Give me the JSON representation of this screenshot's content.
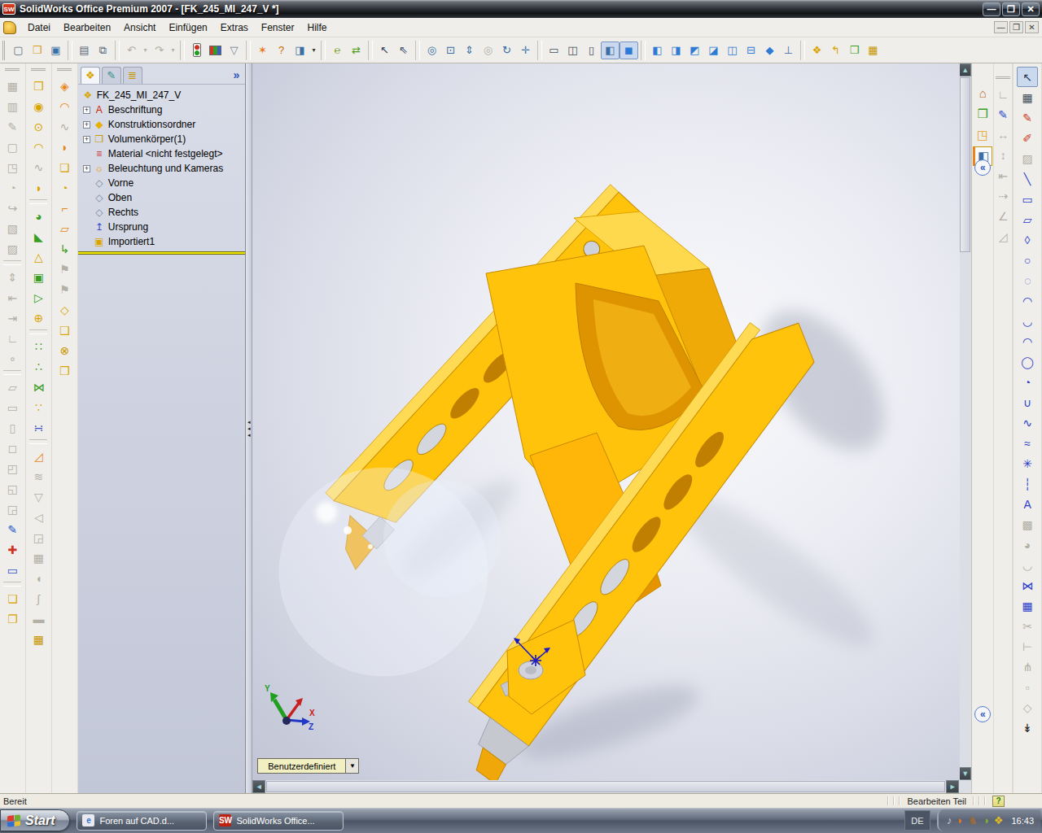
{
  "window": {
    "logo_text": "SW",
    "title": "SolidWorks Office Premium 2007 - [FK_245_MI_247_V *]",
    "controls": [
      {
        "n": "minimize",
        "g": "—"
      },
      {
        "n": "restore",
        "g": "❐"
      },
      {
        "n": "close",
        "g": "✕"
      }
    ]
  },
  "menubar": {
    "menus": [
      "Datei",
      "Bearbeiten",
      "Ansicht",
      "Einfügen",
      "Extras",
      "Fenster",
      "Hilfe"
    ],
    "mdi": [
      {
        "n": "mdi-minimize",
        "g": "—"
      },
      {
        "n": "mdi-restore",
        "g": "❐"
      },
      {
        "n": "mdi-close",
        "g": "✕"
      }
    ]
  },
  "toolbars": {
    "top": [
      "=",
      {
        "n": "new-document",
        "g": "▢",
        "c": "#5A6B7C"
      },
      {
        "n": "open-document",
        "g": "❒",
        "c": "#D99A1E"
      },
      {
        "n": "save",
        "g": "▣",
        "c": "#3A6EA5"
      },
      "|",
      {
        "n": "print",
        "g": "▤",
        "c": "#5A6B7C"
      },
      {
        "n": "print-preview",
        "g": "⧉",
        "c": "#5A6B7C"
      },
      "|",
      {
        "n": "undo",
        "g": "↶",
        "dis": 1
      },
      {
        "n": "undo-dropdown",
        "g": "▾",
        "dis": 1,
        "sm": 1
      },
      {
        "n": "redo",
        "g": "↷",
        "dis": 1
      },
      {
        "n": "redo-dropdown",
        "g": "▾",
        "dis": 1,
        "sm": 1
      },
      "|",
      {
        "n": "rebuild",
        "cls": "tl",
        "g": " "
      },
      {
        "n": "edit-color",
        "cls": "pal",
        "g": " "
      },
      {
        "n": "selection-filter",
        "g": "▽",
        "c": "#6A7B8C"
      },
      "|",
      {
        "n": "whats-wrong",
        "g": "✶",
        "c": "#E87B1E"
      },
      {
        "n": "help",
        "g": "?",
        "c": "#C96A00"
      },
      {
        "n": "task-pane-toggle",
        "g": "◨",
        "c": "#3A6EA5"
      },
      {
        "n": "task-pane-dropdown",
        "g": "▾",
        "c": "#333",
        "sm": 1
      },
      "|",
      {
        "n": "edrawings-publish",
        "g": "℮",
        "c": "#7AA11E"
      },
      {
        "n": "edrawings-animate",
        "g": "⇄",
        "c": "#4E9E1E"
      },
      "|",
      {
        "n": "select",
        "g": "↖",
        "c": "#2A3B56"
      },
      {
        "n": "magnified-selection",
        "g": "⇖",
        "c": "#2A3B56"
      },
      "|",
      {
        "n": "zoom-to-fit",
        "g": "◎",
        "c": "#3A6EA5"
      },
      {
        "n": "zoom-to-area",
        "g": "⊡",
        "c": "#3A6EA5"
      },
      {
        "n": "zoom-in-out",
        "g": "⇕",
        "c": "#3A6EA5"
      },
      {
        "n": "zoom-to-selection",
        "g": "◎",
        "dis": 1
      },
      {
        "n": "rotate-view",
        "g": "↻",
        "c": "#3A6EA5"
      },
      {
        "n": "pan",
        "g": "✛",
        "c": "#3A6EA5"
      },
      "|",
      {
        "n": "wireframe",
        "g": "▭",
        "c": "#44505C"
      },
      {
        "n": "hidden-lines-visible",
        "g": "◫",
        "c": "#44505C"
      },
      {
        "n": "hidden-lines-removed",
        "g": "▯",
        "c": "#44505C"
      },
      {
        "n": "shaded-with-edges",
        "g": "◧",
        "c": "#3A6EA5",
        "pr": 1
      },
      {
        "n": "shaded",
        "g": "◼",
        "c": "#2E7BD6",
        "pr": 1
      },
      "|",
      {
        "n": "view-front",
        "g": "◧",
        "c": "#2E7BD6"
      },
      {
        "n": "view-back",
        "g": "◨",
        "c": "#2E7BD6"
      },
      {
        "n": "view-left",
        "g": "◩",
        "c": "#2E7BD6"
      },
      {
        "n": "view-right",
        "g": "◪",
        "c": "#2E7BD6"
      },
      {
        "n": "view-top",
        "g": "◫",
        "c": "#2E7BD6"
      },
      {
        "n": "view-bottom",
        "g": "⊟",
        "c": "#2E7BD6"
      },
      {
        "n": "view-isometric",
        "g": "◆",
        "c": "#2E7BD6"
      },
      {
        "n": "normal-to",
        "g": "⊥",
        "c": "#3A6EA5"
      },
      "|",
      {
        "n": "photoworks-render",
        "g": "❖",
        "c": "#D9A400"
      },
      {
        "n": "featureworks",
        "g": "↰",
        "c": "#D9A400"
      },
      {
        "n": "design-binder",
        "g": "❒",
        "c": "#3A9D23"
      },
      {
        "n": "toolbox",
        "g": "▦",
        "c": "#C99700"
      }
    ],
    "left1": [
      "=",
      {
        "n": "make-block",
        "g": "▦",
        "dis": 1
      },
      {
        "n": "edit-block",
        "g": "▥",
        "dis": 1
      },
      {
        "n": "insert-block",
        "g": "✎",
        "dis": 1
      },
      {
        "n": "add-to-library",
        "g": "▢",
        "dis": 1
      },
      {
        "n": "save-block",
        "g": "◳",
        "dis": 1
      },
      {
        "n": "explode-block",
        "g": "◔",
        "dis": 1
      },
      {
        "n": "belt-chain",
        "g": "↪",
        "dis": 1
      },
      {
        "n": "format-painter",
        "g": "▧",
        "dis": 1
      },
      {
        "n": "area-hatch-fill",
        "g": "▨",
        "dis": 1
      },
      "|",
      {
        "n": "vertical-dimension",
        "g": "⇕",
        "dis": 1
      },
      {
        "n": "baseline-dimension",
        "g": "⇤",
        "dis": 1
      },
      {
        "n": "ordinate-dimension",
        "g": "⇥",
        "dis": 1
      },
      {
        "n": "chamfer-dimension",
        "g": "∟",
        "dis": 1
      },
      {
        "n": "point-dimension",
        "g": "∘",
        "dis": 1
      },
      "|",
      {
        "n": "view-cube-1",
        "g": "▱",
        "dis": 1
      },
      {
        "n": "view-cube-2",
        "g": "▭",
        "dis": 1
      },
      {
        "n": "view-cube-3",
        "g": "▯",
        "dis": 1
      },
      {
        "n": "view-cube-4",
        "g": "◻",
        "dis": 1
      },
      {
        "n": "view-cube-5",
        "g": "◰",
        "dis": 1
      },
      {
        "n": "view-cube-6",
        "g": "◱",
        "dis": 1
      },
      {
        "n": "view-cube-7",
        "g": "◲",
        "dis": 1
      },
      {
        "n": "sketch-tool",
        "g": "✎",
        "c": "#2255CC"
      },
      {
        "n": "derived-sketch",
        "g": "✚",
        "c": "#CC3322"
      },
      {
        "n": "sketch-picture",
        "g": "▭",
        "c": "#3355CC"
      },
      "|",
      {
        "n": "planar-surface",
        "g": "❏",
        "c": "#D9A400"
      },
      {
        "n": "offset-surface",
        "g": "❐",
        "c": "#D9A400"
      }
    ],
    "left2": [
      "=",
      {
        "n": "extruded-boss",
        "g": "❒",
        "c": "#D9A400"
      },
      {
        "n": "revolved-boss",
        "g": "◉",
        "c": "#D9A400"
      },
      {
        "n": "revolve-thin",
        "g": "⊙",
        "c": "#D9A400"
      },
      {
        "n": "dome",
        "g": "◠",
        "c": "#D9A400"
      },
      {
        "n": "swept-boss",
        "g": "∿",
        "dis": 1
      },
      {
        "n": "lofted-boss",
        "g": "◗",
        "c": "#D9A400"
      },
      "|",
      {
        "n": "fillet",
        "g": "◕",
        "c": "#3A9D23"
      },
      {
        "n": "chamfer",
        "g": "◣",
        "c": "#3A9D23"
      },
      {
        "n": "rib",
        "g": "△",
        "c": "#D9A400"
      },
      {
        "n": "shell",
        "g": "▣",
        "c": "#3A9D23"
      },
      {
        "n": "draft",
        "g": "▷",
        "c": "#3A9D23"
      },
      {
        "n": "hole-wizard",
        "g": "⊕",
        "c": "#D9A400"
      },
      "|",
      {
        "n": "linear-pattern",
        "g": "∷",
        "c": "#3A9D23"
      },
      {
        "n": "circular-pattern",
        "g": "∴",
        "c": "#3A9D23"
      },
      {
        "n": "mirror-feature",
        "g": "⋈",
        "c": "#3A9D23"
      },
      {
        "n": "curve-driven-pattern",
        "g": "∵",
        "c": "#D9A400"
      },
      {
        "n": "sketch-driven-pattern",
        "g": "∺",
        "c": "#3A4ECC"
      },
      "|",
      {
        "n": "rip",
        "g": "◿",
        "c": "#E8861A"
      },
      {
        "n": "insert-bends",
        "g": "≋",
        "dis": 1
      },
      {
        "n": "fold",
        "g": "▽",
        "dis": 1
      },
      {
        "n": "unfold",
        "g": "◁",
        "dis": 1
      },
      {
        "n": "sheet-gusset",
        "g": "◲",
        "dis": 1
      },
      {
        "n": "cross-break",
        "g": "▦",
        "dis": 1
      },
      {
        "n": "corner-relief",
        "g": "◖",
        "dis": 1
      },
      {
        "n": "welded-corner",
        "g": "∫",
        "dis": 1
      },
      {
        "n": "flatten",
        "g": "▬",
        "dis": 1
      },
      {
        "n": "convert-to-sheetmetal",
        "g": "▦",
        "c": "#C99700"
      }
    ],
    "left3": [
      "=",
      {
        "n": "base-flange",
        "g": "◈",
        "c": "#E8861A"
      },
      {
        "n": "sketched-bend",
        "g": "◠",
        "c": "#E8861A"
      },
      {
        "n": "swept-flange",
        "g": "∿",
        "dis": 1
      },
      {
        "n": "lofted-bend",
        "g": "◗",
        "c": "#E8861A"
      },
      {
        "n": "edge-flange",
        "g": "❏",
        "c": "#D9A400"
      },
      {
        "n": "hem",
        "g": "◔",
        "c": "#D9A400"
      },
      {
        "n": "jog",
        "g": "⌐",
        "c": "#E8861A"
      },
      {
        "n": "miter-flange",
        "g": "▱",
        "c": "#E8861A"
      },
      {
        "n": "convert-entities-feature",
        "g": "↳",
        "c": "#3A9D23"
      },
      {
        "n": "forming-tool-1",
        "g": "⚑",
        "dis": 1
      },
      {
        "n": "forming-tool-2",
        "g": "⚑",
        "dis": 1
      },
      {
        "n": "extruded-cut",
        "g": "◇",
        "c": "#D9A400"
      },
      {
        "n": "revolved-cut",
        "g": "❑",
        "c": "#D9A400"
      },
      {
        "n": "simple-hole",
        "g": "⊗",
        "c": "#C99700"
      },
      {
        "n": "thickened-cut",
        "g": "❒",
        "c": "#D9A400"
      }
    ],
    "dim": [
      "=",
      {
        "n": "smart-dimension",
        "g": "∟",
        "dis": 1
      },
      {
        "n": "model-items",
        "g": "✎",
        "c": "#2E4ECC"
      },
      {
        "n": "horizontal-dimension",
        "g": "↔",
        "dis": 1
      },
      {
        "n": "vertical-dimension-2",
        "g": "↕",
        "dis": 1
      },
      {
        "n": "baseline-dimension-2",
        "g": "⇤",
        "dis": 1
      },
      {
        "n": "ordinate-dimension-2",
        "g": "⇢",
        "dis": 1
      },
      {
        "n": "chamfer-dimension-2",
        "g": "∠",
        "dis": 1
      },
      {
        "n": "autodimension",
        "g": "◿",
        "dis": 1
      }
    ],
    "sketch": [
      {
        "n": "select-arrow",
        "g": "↖",
        "c": "#2A3B56",
        "pr": 1
      },
      {
        "n": "grid",
        "g": "▦",
        "c": "#44505C"
      },
      {
        "n": "sketch",
        "g": "✎",
        "c": "#CC3A1E"
      },
      {
        "n": "3d-sketch",
        "g": "✐",
        "c": "#CC3A1E"
      },
      {
        "n": "modify-sketch",
        "g": "▨",
        "dis": 1
      },
      {
        "n": "line",
        "g": "╲",
        "c": "#2E3ECC"
      },
      {
        "n": "corner-rectangle",
        "g": "▭",
        "c": "#2E3ECC"
      },
      {
        "n": "parallelogram",
        "g": "▱",
        "c": "#2E3ECC"
      },
      {
        "n": "polygon",
        "g": "◊",
        "c": "#2E3ECC"
      },
      {
        "n": "circle",
        "g": "○",
        "c": "#2E3ECC"
      },
      {
        "n": "perimeter-circle",
        "g": "◌",
        "c": "#2E3ECC"
      },
      {
        "n": "centerpoint-arc",
        "g": "◠",
        "c": "#2E3ECC"
      },
      {
        "n": "tangent-arc",
        "g": "◡",
        "c": "#2E3ECC"
      },
      {
        "n": "3-point-arc",
        "g": "◠",
        "c": "#2E3ECC"
      },
      {
        "n": "ellipse",
        "g": "◯",
        "c": "#2E3ECC"
      },
      {
        "n": "partial-ellipse",
        "g": "◔",
        "c": "#2E3ECC"
      },
      {
        "n": "parabola",
        "g": "∪",
        "c": "#2E3ECC"
      },
      {
        "n": "spline",
        "g": "∿",
        "c": "#2E3ECC"
      },
      {
        "n": "spline-on-surface",
        "g": "≈",
        "c": "#2E3ECC"
      },
      {
        "n": "point",
        "g": "✳",
        "c": "#2E3ECC"
      },
      {
        "n": "centerline",
        "g": "┆",
        "c": "#2E3ECC"
      },
      {
        "n": "text",
        "g": "A",
        "c": "#2E3ECC"
      },
      {
        "n": "area-hatch",
        "g": "▩",
        "dis": 1
      },
      {
        "n": "sketch-fillet",
        "g": "◕",
        "dis": 1
      },
      {
        "n": "offset-entities",
        "g": "◡",
        "dis": 1
      },
      {
        "n": "mirror-entities",
        "g": "⋈",
        "c": "#2E3ECC"
      },
      {
        "n": "linear-sketch-pattern",
        "g": "▦",
        "c": "#2E3ECC"
      },
      {
        "n": "trim-entities",
        "g": "✂",
        "dis": 1
      },
      {
        "n": "extend-entities",
        "g": "⊢",
        "dis": 1
      },
      {
        "n": "split-entities",
        "g": "⋔",
        "dis": 1
      },
      {
        "n": "move-entities",
        "g": "▫",
        "dis": 1
      },
      {
        "n": "rotate-entities",
        "g": "◇",
        "dis": 1
      },
      {
        "n": "more-tools",
        "g": "↡",
        "c": "#222"
      }
    ],
    "taskpane": [
      {
        "n": "solidworks-resources-tab",
        "g": "⌂",
        "c": "#B8651F"
      },
      {
        "n": "design-library-tab",
        "g": "❒",
        "c": "#3A9D23"
      },
      {
        "n": "file-explorer-tab",
        "g": "◳",
        "c": "#E8A32A"
      },
      {
        "n": "custom-properties-tab",
        "g": "◧",
        "c": "#3A6EA5",
        "active": 1
      }
    ]
  },
  "tree": {
    "tabs_chevron": "»",
    "root": {
      "id": "root-part",
      "label": "FK_245_MI_247_V",
      "g": "❖",
      "c": "#D9A400"
    },
    "items": [
      {
        "id": "beschriftung",
        "label": "Beschriftung",
        "plus": 1,
        "g": "A",
        "c": "#CC2200"
      },
      {
        "id": "konstruktionsordner",
        "label": "Konstruktionsordner",
        "plus": 1,
        "g": "◆",
        "c": "#E8B000"
      },
      {
        "id": "volumenkoerper",
        "label": "Volumenkörper(1)",
        "plus": 1,
        "g": "❒",
        "c": "#C99700"
      },
      {
        "id": "material",
        "label": "Material <nicht festgelegt>",
        "plus": 0,
        "g": "≡",
        "c": "#CC3333"
      },
      {
        "id": "beleuchtung",
        "label": "Beleuchtung und Kameras",
        "plus": 1,
        "g": "☼",
        "c": "#E8A000"
      },
      {
        "id": "vorne",
        "label": "Vorne",
        "plus": 0,
        "g": "◇",
        "c": "#7A8CA0"
      },
      {
        "id": "oben",
        "label": "Oben",
        "plus": 0,
        "g": "◇",
        "c": "#7A8CA0"
      },
      {
        "id": "rechts",
        "label": "Rechts",
        "plus": 0,
        "g": "◇",
        "c": "#7A8CA0"
      },
      {
        "id": "ursprung",
        "label": "Ursprung",
        "plus": 0,
        "g": "↥",
        "c": "#3344CC"
      },
      {
        "id": "importiert1",
        "label": "Importiert1",
        "plus": 0,
        "g": "▣",
        "c": "#D9A400"
      }
    ]
  },
  "viewport": {
    "view_selector": {
      "value": "Benutzerdefiniert"
    },
    "triad": {
      "x": "X",
      "y": "Y",
      "z": "Z"
    },
    "part_colors": {
      "body": "#FFC30B",
      "shadow_face": "#EFAA08",
      "highlight_face": "#FFD94D",
      "channel": "#DE9400",
      "slot": "#C07F00",
      "cut_face": "#C6C8D0"
    }
  },
  "statusbar": {
    "ready": "Bereit",
    "mode": "Bearbeiten Teil",
    "help": "?"
  },
  "taskbar": {
    "start_label": "Start",
    "tasks": [
      {
        "n": "task-ie-forum",
        "label": "Foren auf CAD.d...",
        "icon_text": "e",
        "icon_bg": "#E8EAF0",
        "icon_color": "#2E6FD6"
      },
      {
        "n": "task-solidworks",
        "label": "SolidWorks Office...",
        "icon_text": "SW",
        "icon_bg": "#C02010",
        "icon_color": "#FFFFFF"
      }
    ],
    "language": "DE",
    "tray": [
      {
        "n": "tray-volume-icon",
        "g": "♪",
        "c": "#C8CCD4"
      },
      {
        "n": "tray-update-icon",
        "g": "◗",
        "c": "#E8761A"
      },
      {
        "n": "tray-app-icon",
        "g": "♞",
        "c": "#9A6A3A"
      },
      {
        "n": "tray-antivirus-icon",
        "g": "◑",
        "c": "#7BB32A"
      },
      {
        "n": "tray-solidworks-icon",
        "g": "❖",
        "c": "#E2BC20"
      }
    ],
    "clock": "16:43"
  }
}
